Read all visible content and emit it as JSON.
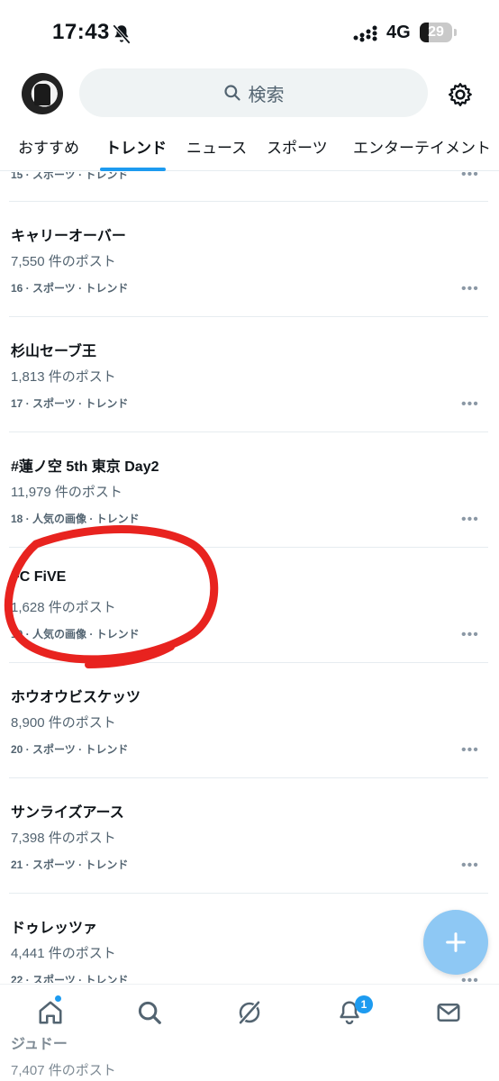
{
  "status_bar": {
    "time": "17:43",
    "network": "4G",
    "battery": "29",
    "battery_level": 0.29
  },
  "header": {
    "search_label": "検索"
  },
  "tabs": [
    {
      "label": "おすすめ"
    },
    {
      "label": "トレンド"
    },
    {
      "label": "ニュース"
    },
    {
      "label": "スポーツ"
    },
    {
      "label": "エンターテイメント"
    }
  ],
  "feed": {
    "partial_top": {
      "meta": "15 · スポーツ · トレンド"
    },
    "items": [
      {
        "title": "キャリーオーバー",
        "posts": "7,550 件のポスト",
        "meta": "16 · スポーツ · トレンド"
      },
      {
        "title": "杉山セーブ王",
        "posts": "1,813 件のポスト",
        "meta": "17 · スポーツ · トレンド"
      },
      {
        "title": "#蓮ノ空 5th 東京 Day2",
        "posts": "11,979 件のポスト",
        "meta": "18 · 人気の画像 · トレンド"
      },
      {
        "title": "FC FiVE",
        "posts": "1,628 件のポスト",
        "meta": "19 · 人気の画像 · トレンド"
      },
      {
        "title": "ホウオウビスケッツ",
        "posts": "8,900 件のポスト",
        "meta": "20 · スポーツ · トレンド"
      },
      {
        "title": "サンライズアース",
        "posts": "7,398 件のポスト",
        "meta": "21 · スポーツ · トレンド"
      },
      {
        "title": "ドゥレッツァ",
        "posts": "4,441 件のポスト",
        "meta": "22 · スポーツ · トレンド"
      }
    ],
    "more_glyph": "•••"
  },
  "bottom_nav": {
    "notification_count": "1",
    "under_item": {
      "title": "ジュドー",
      "posts": "7,407 件のポスト"
    }
  },
  "fab": {
    "icon": "plus-icon"
  },
  "colors": {
    "accent": "#1d9bf0",
    "annotation": "#e8231f",
    "fab": "#8ec8f4"
  }
}
